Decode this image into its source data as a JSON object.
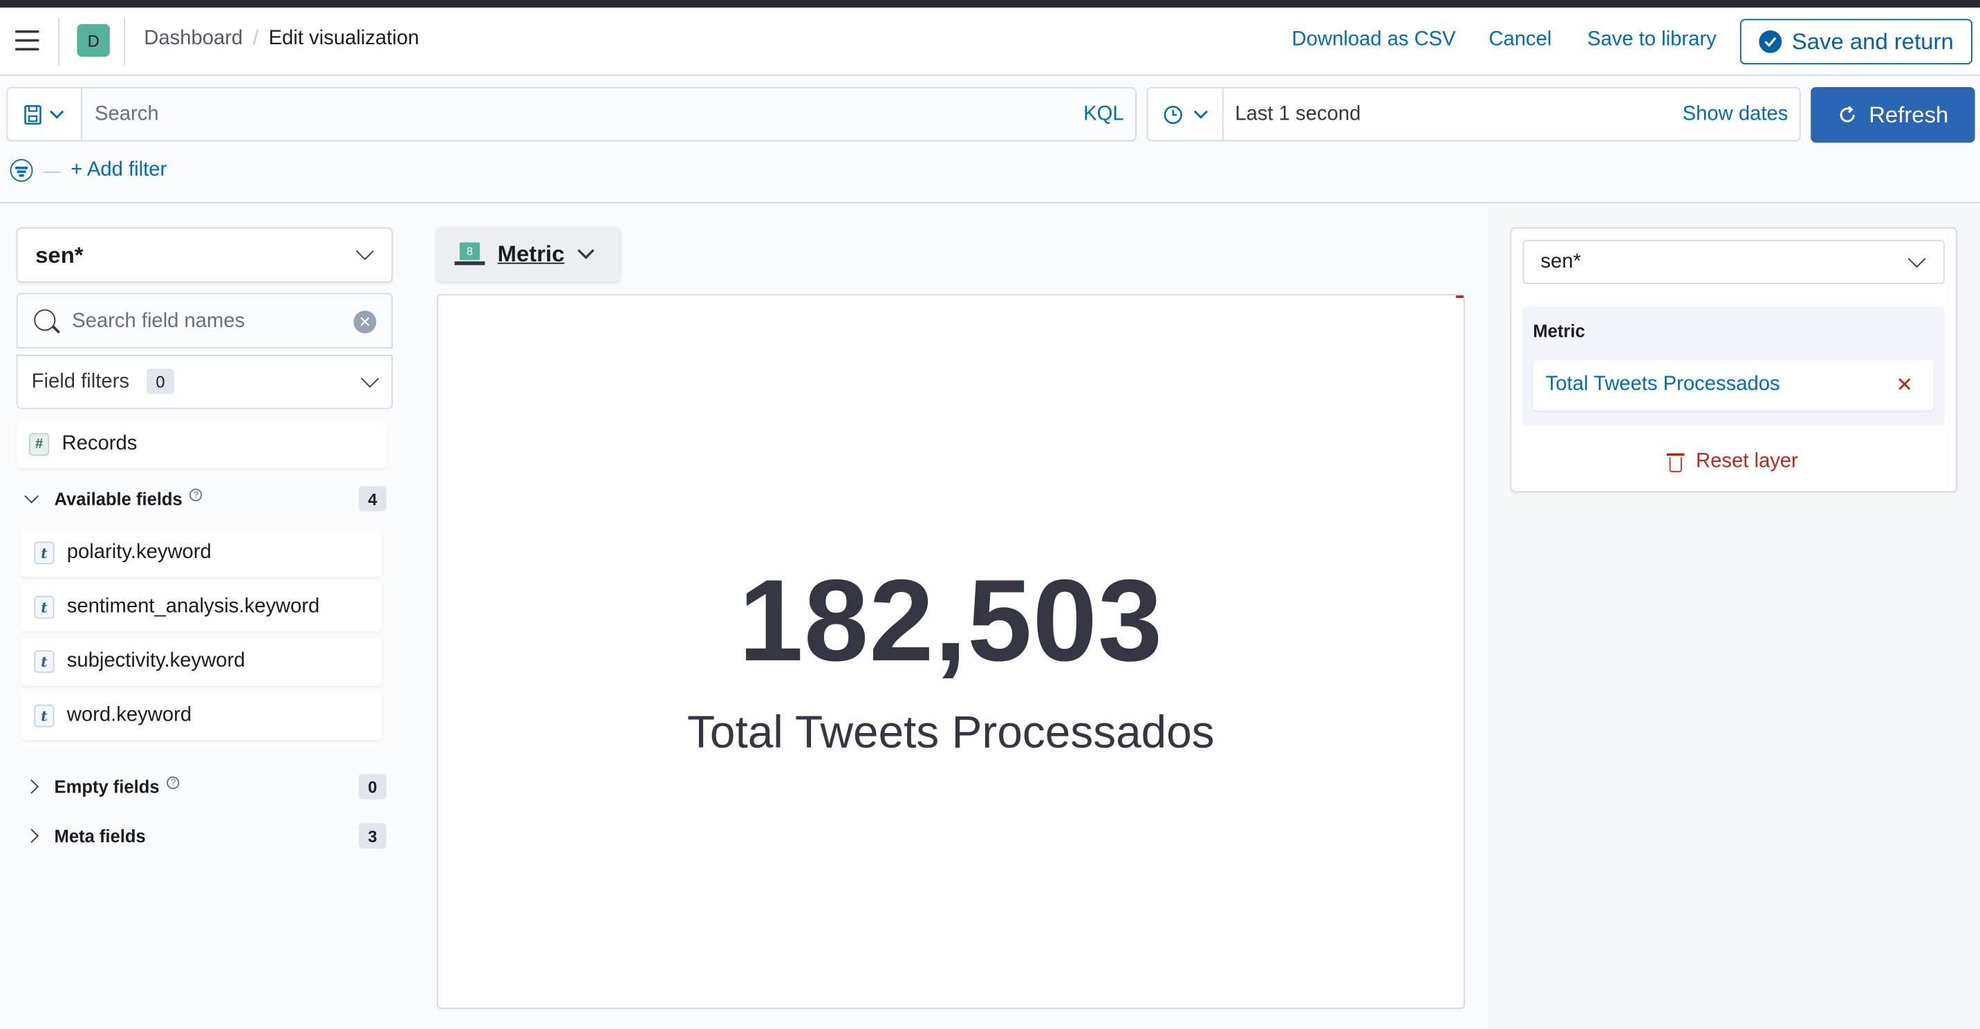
{
  "header": {
    "space_initial": "D",
    "breadcrumbs": [
      "Dashboard",
      "Edit visualization"
    ],
    "actions": {
      "download_csv": "Download as CSV",
      "cancel": "Cancel",
      "save_to_library": "Save to library",
      "save_and_return": "Save and return"
    }
  },
  "query_bar": {
    "search_placeholder": "Search",
    "language": "KQL",
    "time_range": "Last 1 second",
    "show_dates": "Show dates",
    "refresh": "Refresh",
    "add_filter": "+ Add filter"
  },
  "field_list": {
    "index_pattern": "sen*",
    "search_placeholder": "Search field names",
    "field_filters_label": "Field filters",
    "field_filters_count": "0",
    "records_token": "#",
    "records_label": "Records",
    "available": {
      "label": "Available fields",
      "count": "4",
      "fields": [
        {
          "type": "t",
          "name": "polarity.keyword"
        },
        {
          "type": "t",
          "name": "sentiment_analysis.keyword"
        },
        {
          "type": "t",
          "name": "subjectivity.keyword"
        },
        {
          "type": "t",
          "name": "word.keyword"
        }
      ]
    },
    "empty": {
      "label": "Empty fields",
      "count": "0"
    },
    "meta": {
      "label": "Meta fields",
      "count": "3"
    }
  },
  "workspace": {
    "chart_type": "Metric",
    "chart_type_icon_digit": "8",
    "metric_value": "182,503",
    "metric_label": "Total Tweets Processados"
  },
  "config_panel": {
    "index_pattern": "sen*",
    "group_title": "Metric",
    "dimension": "Total Tweets Processados",
    "reset_layer": "Reset layer"
  },
  "colors": {
    "accent": "#006bb8",
    "danger": "#bd271e",
    "primary_button": "#2a66b3",
    "space_avatar": "#54b399"
  }
}
